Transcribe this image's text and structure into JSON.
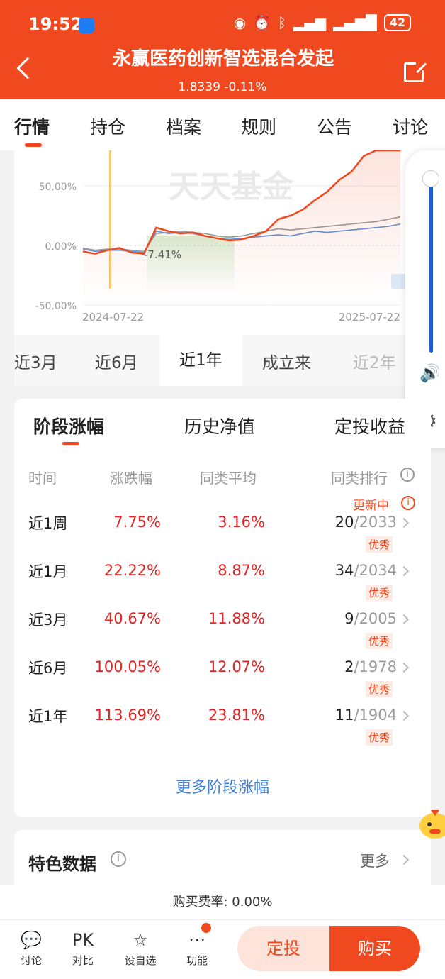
{
  "status": {
    "time": "19:52",
    "battery": "42"
  },
  "header": {
    "title": "永赢医药创新智选混合发起",
    "nav": "1.8339",
    "change": "-0.11%"
  },
  "tabs": [
    "行情",
    "持仓",
    "档案",
    "规则",
    "公告",
    "讨论"
  ],
  "chart": {
    "watermark": "天天基金",
    "y_ticks": [
      "50.00%",
      "0.00%",
      "-50.00%"
    ],
    "x_ticks": [
      "2024-07-22",
      "2025-07-22"
    ],
    "annotation": "-7.41%",
    "colors": {
      "fund": "#f0481f",
      "avg": "#5b8fd9",
      "index": "#999999",
      "down": "#2db32d"
    }
  },
  "chart_data": {
    "type": "line",
    "x_range": [
      "2024-07-22",
      "2025-07-22"
    ],
    "ylim": [
      -50,
      110
    ],
    "series": [
      {
        "values": [
          -5,
          -7,
          -4,
          -2,
          -6,
          -7,
          15,
          12,
          10,
          11,
          8,
          6,
          4,
          5,
          8,
          12,
          22,
          25,
          30,
          38,
          45,
          55,
          62,
          75,
          90,
          105,
          113
        ]
      },
      {
        "values": [
          -3,
          -5,
          -4,
          -4,
          -5,
          -6,
          12,
          10,
          11,
          10,
          8,
          6,
          5,
          6,
          7,
          8,
          9,
          8,
          10,
          12,
          11,
          12,
          13,
          14,
          15,
          16,
          18
        ]
      },
      {
        "values": [
          -2,
          -4,
          -3,
          -3,
          -4,
          -5,
          10,
          11,
          12,
          11,
          10,
          8,
          7,
          8,
          10,
          12,
          14,
          13,
          14,
          15,
          16,
          17,
          18,
          19,
          20,
          22,
          24
        ]
      }
    ]
  },
  "ranges": [
    "近3月",
    "近6月",
    "近1年",
    "成立来",
    "近2年"
  ],
  "returns": {
    "tabs": [
      "阶段涨幅",
      "历史净值",
      "定投收益"
    ],
    "cols": [
      "时间",
      "涨跌幅",
      "同类平均",
      "同类排行"
    ],
    "updating": "更新中",
    "rows": [
      {
        "period": "近1周",
        "pct": "7.75%",
        "avg": "3.16%",
        "rank": "20",
        "total": "/2033",
        "tag": "优秀"
      },
      {
        "period": "近1月",
        "pct": "22.22%",
        "avg": "8.87%",
        "rank": "34",
        "total": "/2034",
        "tag": "优秀"
      },
      {
        "period": "近3月",
        "pct": "40.67%",
        "avg": "11.88%",
        "rank": "9",
        "total": "/2005",
        "tag": "优秀"
      },
      {
        "period": "近6月",
        "pct": "100.05%",
        "avg": "12.07%",
        "rank": "2",
        "total": "/1978",
        "tag": "优秀"
      },
      {
        "period": "近1年",
        "pct": "113.69%",
        "avg": "23.81%",
        "rank": "11",
        "total": "/1904",
        "tag": "优秀"
      }
    ],
    "more": "更多阶段涨幅"
  },
  "feature": {
    "title": "特色数据",
    "more": "更多"
  },
  "fee": "购买费率: 0.00%",
  "bottom": {
    "items": [
      "讨论",
      "对比",
      "设自选",
      "功能"
    ],
    "pk": "PK",
    "dingtou": "定投",
    "buy": "购买"
  }
}
